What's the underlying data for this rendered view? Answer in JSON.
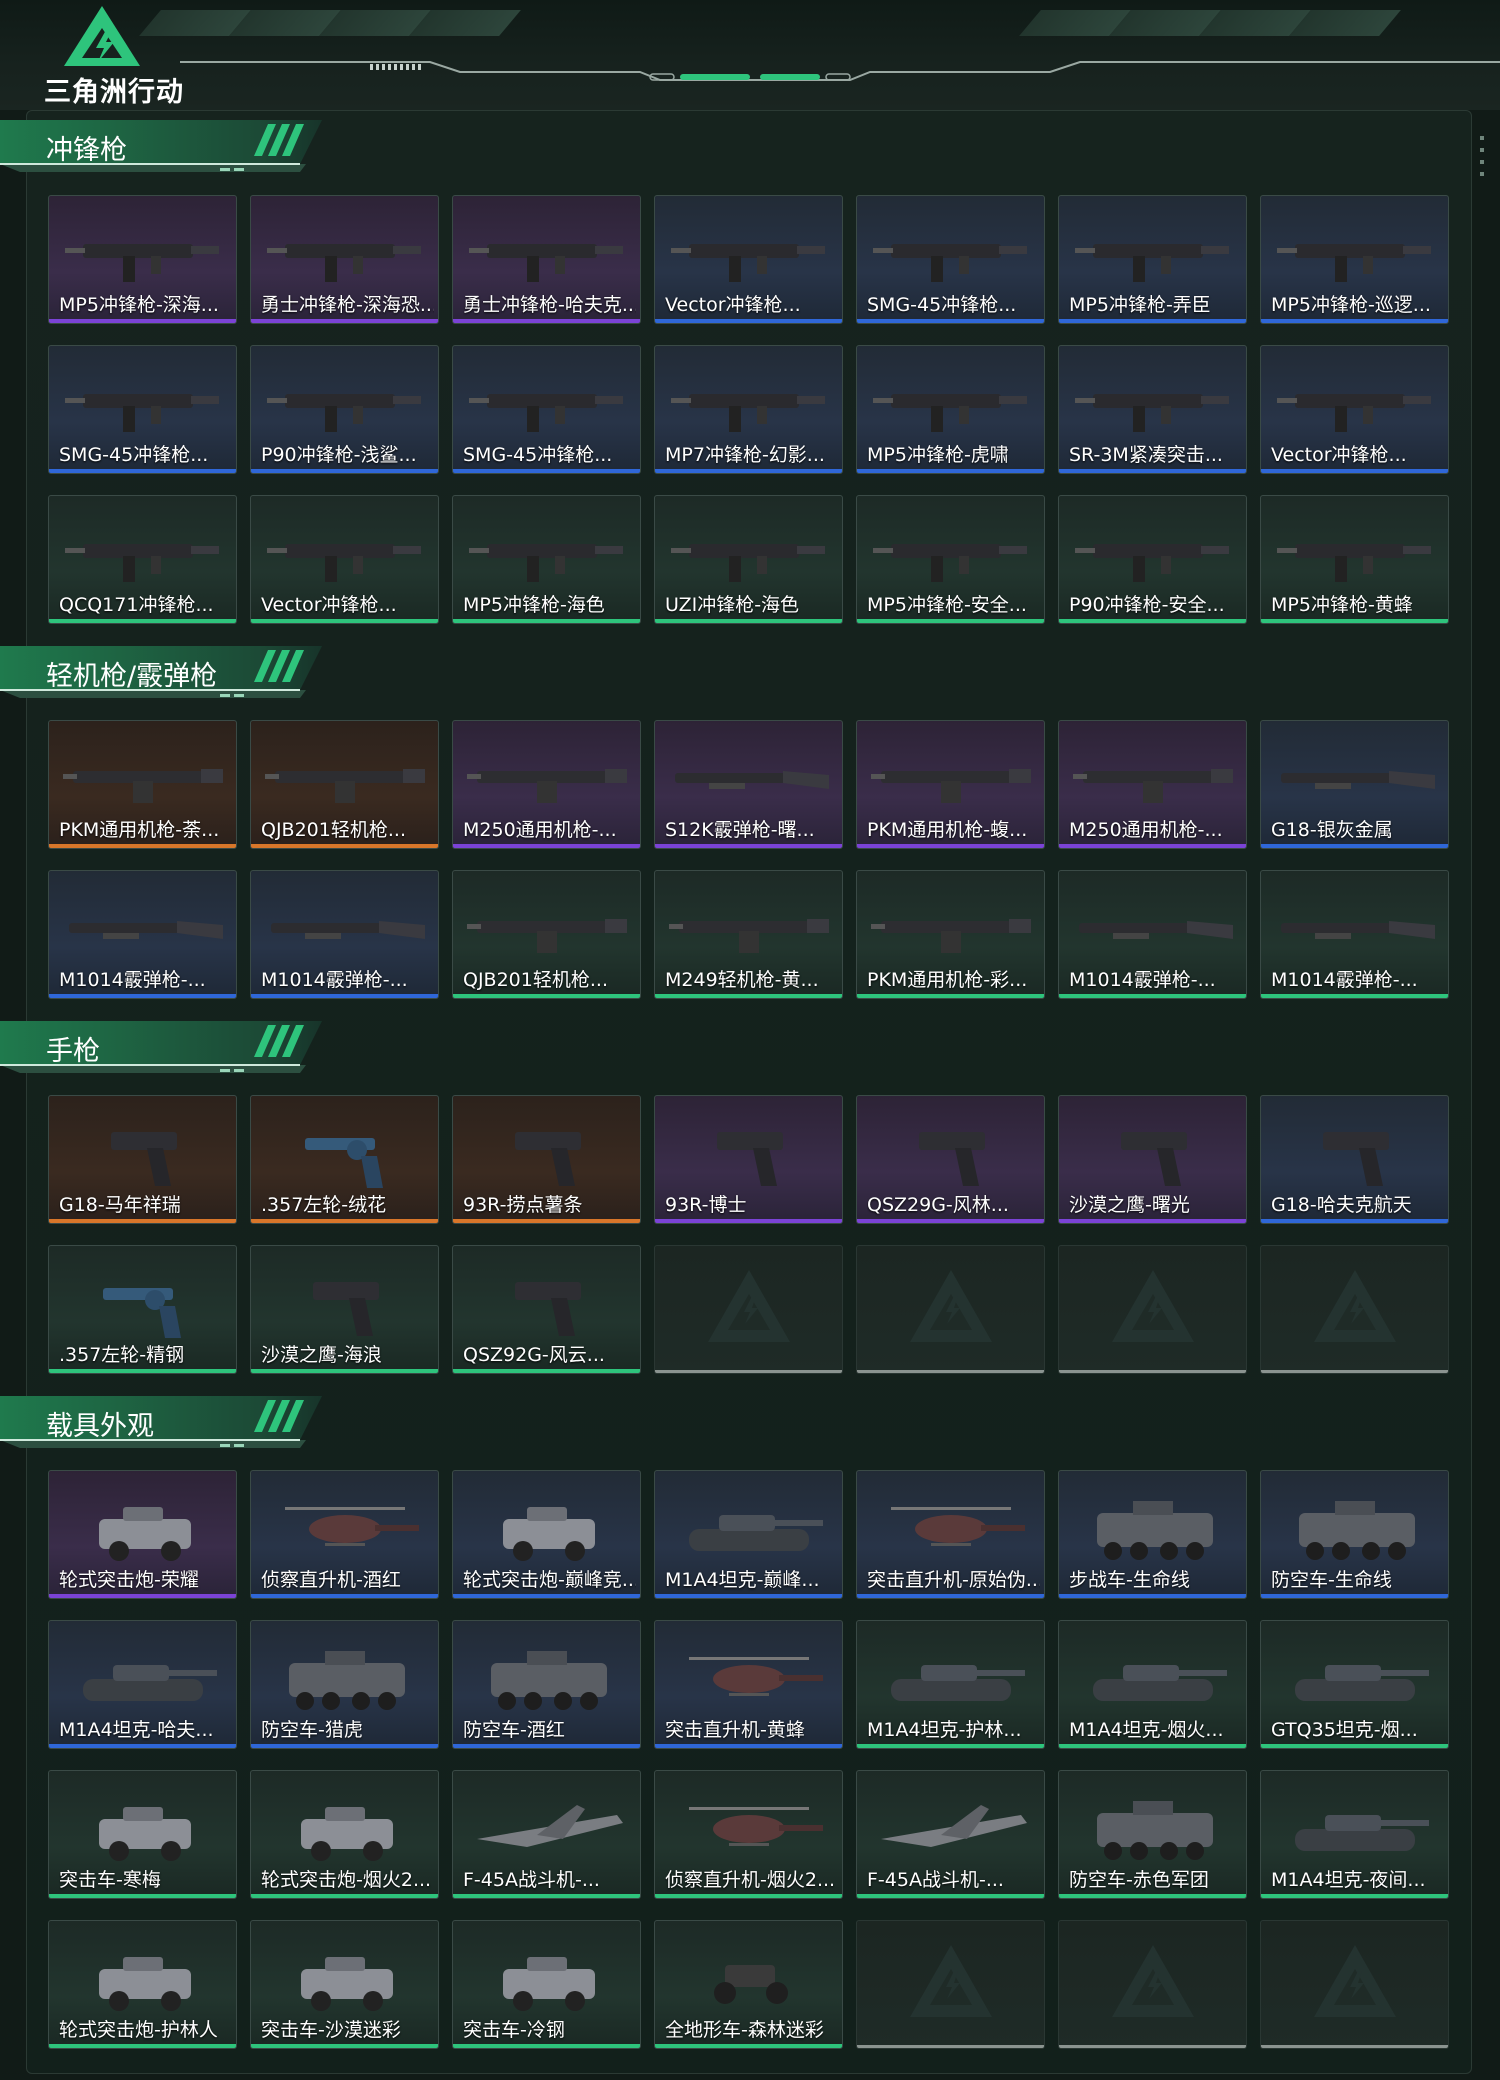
{
  "app": {
    "logo_text": "三角洲行动"
  },
  "sections": [
    {
      "title": "冲锋枪",
      "items": [
        {
          "label": "MP5冲锋枪-深海...",
          "rarity": "purple",
          "icon": "smg-icon"
        },
        {
          "label": "勇士冲锋枪-深海恐...",
          "rarity": "purple",
          "icon": "smg-icon"
        },
        {
          "label": "勇士冲锋枪-哈夫克...",
          "rarity": "purple",
          "icon": "smg-icon"
        },
        {
          "label": "Vector冲锋枪...",
          "rarity": "blue",
          "icon": "smg-icon"
        },
        {
          "label": "SMG-45冲锋枪...",
          "rarity": "blue",
          "icon": "smg-icon"
        },
        {
          "label": "MP5冲锋枪-弄臣",
          "rarity": "blue",
          "icon": "smg-icon"
        },
        {
          "label": "MP5冲锋枪-巡逻...",
          "rarity": "blue",
          "icon": "smg-icon"
        },
        {
          "label": "SMG-45冲锋枪...",
          "rarity": "blue",
          "icon": "smg-icon"
        },
        {
          "label": "P90冲锋枪-浅鲨...",
          "rarity": "blue",
          "icon": "smg-icon"
        },
        {
          "label": "SMG-45冲锋枪...",
          "rarity": "blue",
          "icon": "smg-icon"
        },
        {
          "label": "MP7冲锋枪-幻影...",
          "rarity": "blue",
          "icon": "smg-icon"
        },
        {
          "label": "MP5冲锋枪-虎啸",
          "rarity": "blue",
          "icon": "smg-icon"
        },
        {
          "label": "SR-3M紧凑突击...",
          "rarity": "blue",
          "icon": "smg-icon"
        },
        {
          "label": "Vector冲锋枪...",
          "rarity": "blue",
          "icon": "smg-icon"
        },
        {
          "label": "QCQ171冲锋枪...",
          "rarity": "green",
          "icon": "smg-icon"
        },
        {
          "label": "Vector冲锋枪...",
          "rarity": "green",
          "icon": "smg-icon"
        },
        {
          "label": "MP5冲锋枪-海色",
          "rarity": "green",
          "icon": "smg-icon"
        },
        {
          "label": "UZI冲锋枪-海色",
          "rarity": "green",
          "icon": "smg-icon"
        },
        {
          "label": "MP5冲锋枪-安全...",
          "rarity": "green",
          "icon": "smg-icon"
        },
        {
          "label": "P90冲锋枪-安全...",
          "rarity": "green",
          "icon": "smg-icon"
        },
        {
          "label": "MP5冲锋枪-黄蜂",
          "rarity": "green",
          "icon": "smg-icon"
        }
      ]
    },
    {
      "title": "轻机枪/霰弹枪",
      "items": [
        {
          "label": "PKM通用机枪-荼...",
          "rarity": "orange",
          "icon": "lmg-icon"
        },
        {
          "label": "QJB201轻机枪...",
          "rarity": "orange",
          "icon": "lmg-icon"
        },
        {
          "label": "M250通用机枪-...",
          "rarity": "purple",
          "icon": "lmg-icon"
        },
        {
          "label": "S12K霰弹枪-曙...",
          "rarity": "purple",
          "icon": "shotgun-icon"
        },
        {
          "label": "PKM通用机枪-蝮...",
          "rarity": "purple",
          "icon": "lmg-icon"
        },
        {
          "label": "M250通用机枪-...",
          "rarity": "purple",
          "icon": "lmg-icon"
        },
        {
          "label": "G18-银灰金属",
          "rarity": "blue",
          "icon": "shotgun-icon"
        },
        {
          "label": "M1014霰弹枪-...",
          "rarity": "blue",
          "icon": "shotgun-icon"
        },
        {
          "label": "M1014霰弹枪-...",
          "rarity": "blue",
          "icon": "shotgun-icon"
        },
        {
          "label": "QJB201轻机枪...",
          "rarity": "green",
          "icon": "lmg-icon"
        },
        {
          "label": "M249轻机枪-黄...",
          "rarity": "green",
          "icon": "lmg-icon"
        },
        {
          "label": "PKM通用机枪-彩...",
          "rarity": "green",
          "icon": "lmg-icon"
        },
        {
          "label": "M1014霰弹枪-...",
          "rarity": "green",
          "icon": "shotgun-icon"
        },
        {
          "label": "M1014霰弹枪-...",
          "rarity": "green",
          "icon": "shotgun-icon"
        }
      ]
    },
    {
      "title": "手枪",
      "items": [
        {
          "label": "G18-马年祥瑞",
          "rarity": "orange",
          "icon": "pistol-icon"
        },
        {
          "label": ".357左轮-绒花",
          "rarity": "orange",
          "icon": "revolver-icon"
        },
        {
          "label": "93R-捞点薯条",
          "rarity": "orange",
          "icon": "pistol-icon"
        },
        {
          "label": "93R-博士",
          "rarity": "purple",
          "icon": "pistol-icon"
        },
        {
          "label": "QSZ29G-风林...",
          "rarity": "purple",
          "icon": "pistol-icon"
        },
        {
          "label": "沙漠之鹰-曙光",
          "rarity": "purple",
          "icon": "pistol-icon"
        },
        {
          "label": "G18-哈夫克航天",
          "rarity": "blue",
          "icon": "pistol-icon"
        },
        {
          "label": ".357左轮-精钢",
          "rarity": "green",
          "icon": "revolver-icon"
        },
        {
          "label": "沙漠之鹰-海浪",
          "rarity": "green",
          "icon": "pistol-icon"
        },
        {
          "label": "QSZ92G-风云...",
          "rarity": "green",
          "icon": "pistol-icon"
        },
        {
          "label": "",
          "rarity": "empty",
          "icon": "placeholder-logo-icon"
        },
        {
          "label": "",
          "rarity": "empty",
          "icon": "placeholder-logo-icon"
        },
        {
          "label": "",
          "rarity": "empty",
          "icon": "placeholder-logo-icon"
        },
        {
          "label": "",
          "rarity": "empty",
          "icon": "placeholder-logo-icon"
        }
      ]
    },
    {
      "title": "载具外观",
      "items": [
        {
          "label": "轮式突击炮-荣耀",
          "rarity": "purple",
          "icon": "armored-car-icon"
        },
        {
          "label": "侦察直升机-酒红",
          "rarity": "blue",
          "icon": "helicopter-icon"
        },
        {
          "label": "轮式突击炮-巅峰竞...",
          "rarity": "blue",
          "icon": "armored-car-icon"
        },
        {
          "label": "M1A4坦克-巅峰...",
          "rarity": "blue",
          "icon": "tank-icon"
        },
        {
          "label": "突击直升机-原始伪...",
          "rarity": "blue",
          "icon": "helicopter-icon"
        },
        {
          "label": "步战车-生命线",
          "rarity": "blue",
          "icon": "apc-icon"
        },
        {
          "label": "防空车-生命线",
          "rarity": "blue",
          "icon": "apc-icon"
        },
        {
          "label": "M1A4坦克-哈夫...",
          "rarity": "blue",
          "icon": "tank-icon"
        },
        {
          "label": "防空车-猎虎",
          "rarity": "blue",
          "icon": "apc-icon"
        },
        {
          "label": "防空车-酒红",
          "rarity": "blue",
          "icon": "apc-icon"
        },
        {
          "label": "突击直升机-黄蜂",
          "rarity": "blue",
          "icon": "helicopter-icon"
        },
        {
          "label": "M1A4坦克-护林...",
          "rarity": "green",
          "icon": "tank-icon"
        },
        {
          "label": "M1A4坦克-烟火...",
          "rarity": "green",
          "icon": "tank-icon"
        },
        {
          "label": "GTQ35坦克-烟...",
          "rarity": "green",
          "icon": "tank-icon"
        },
        {
          "label": "突击车-寒梅",
          "rarity": "green",
          "icon": "armored-car-icon"
        },
        {
          "label": "轮式突击炮-烟火2...",
          "rarity": "green",
          "icon": "armored-car-icon"
        },
        {
          "label": "F-45A战斗机-...",
          "rarity": "green",
          "icon": "jet-icon"
        },
        {
          "label": "侦察直升机-烟火2...",
          "rarity": "green",
          "icon": "helicopter-icon"
        },
        {
          "label": "F-45A战斗机-...",
          "rarity": "green",
          "icon": "jet-icon"
        },
        {
          "label": "防空车-赤色军团",
          "rarity": "green",
          "icon": "apc-icon"
        },
        {
          "label": "M1A4坦克-夜间...",
          "rarity": "green",
          "icon": "tank-icon"
        },
        {
          "label": "轮式突击炮-护林人",
          "rarity": "green",
          "icon": "armored-car-icon"
        },
        {
          "label": "突击车-沙漠迷彩",
          "rarity": "green",
          "icon": "armored-car-icon"
        },
        {
          "label": "突击车-冷钢",
          "rarity": "green",
          "icon": "armored-car-icon"
        },
        {
          "label": "全地形车-森林迷彩",
          "rarity": "green",
          "icon": "atv-icon"
        },
        {
          "label": "",
          "rarity": "empty",
          "icon": "placeholder-logo-icon"
        },
        {
          "label": "",
          "rarity": "empty",
          "icon": "placeholder-logo-icon"
        },
        {
          "label": "",
          "rarity": "empty",
          "icon": "placeholder-logo-icon"
        }
      ]
    }
  ],
  "colors": {
    "accent_green": "#2ec47c",
    "rarity_purple": "#7b43d6",
    "rarity_blue": "#2f67d8",
    "rarity_green": "#2ec47c",
    "rarity_orange": "#d8762a",
    "rarity_empty": "#8b9490"
  }
}
